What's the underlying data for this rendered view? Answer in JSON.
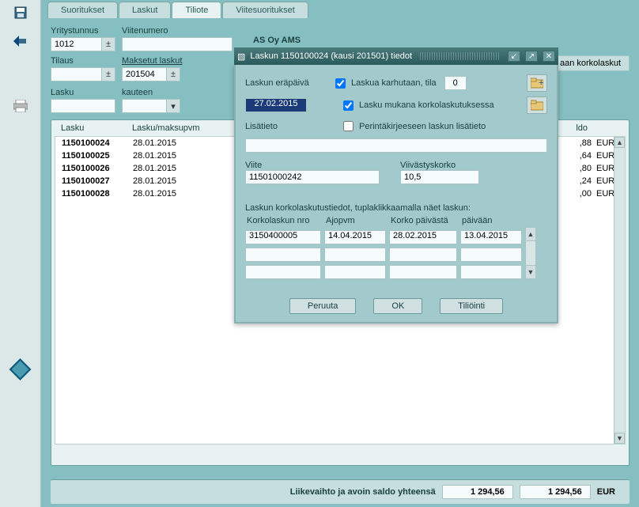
{
  "tabs": {
    "suoritukset": "Suoritukset",
    "laskut": "Laskut",
    "tiliote": "Tiliote",
    "viitesuoritukset": "Viitesuoritukset"
  },
  "filters": {
    "yritystunnus_label": "Yritystunnus",
    "yritystunnus_value": "1012",
    "tilaus_label": "Tilaus",
    "lasku_label": "Lasku",
    "viitenumero_label": "Viitenumero",
    "maksetut_label": "Maksetut laskut",
    "maksetut_value": "201504",
    "kauteen_label": "kauteen"
  },
  "company": "AS Oy AMS",
  "side_button": "aan korkolaskut",
  "list": {
    "head_lasku": "Lasku",
    "head_pvm": "Lasku/maksupvm",
    "head_saldo": "ldo",
    "rows": [
      {
        "lasku": "1150100024",
        "pvm": "28.01.2015",
        "saldo": ",88",
        "cur": "EUR"
      },
      {
        "lasku": "1150100025",
        "pvm": "28.01.2015",
        "saldo": ",64",
        "cur": "EUR"
      },
      {
        "lasku": "1150100026",
        "pvm": "28.01.2015",
        "saldo": ",80",
        "cur": "EUR"
      },
      {
        "lasku": "1150100027",
        "pvm": "28.01.2015",
        "saldo": ",24",
        "cur": "EUR"
      },
      {
        "lasku": "1150100028",
        "pvm": "28.01.2015",
        "saldo": ",00",
        "cur": "EUR"
      }
    ]
  },
  "footer": {
    "label": "Liikevaihto ja avoin saldo yhteensä",
    "total1": "1 294,56",
    "total2": "1 294,56",
    "cur": "EUR"
  },
  "dialog": {
    "title": "Laskun 1150100024 (kausi 201501) tiedot",
    "erapaiva_label": "Laskun eräpäivä",
    "erapaiva_value": "27.02.2015",
    "chk_karhutaan": "Laskua karhutaan, tila",
    "karhutaan_value": "0",
    "chk_korkolaskutus": "Lasku mukana korkolaskutuksessa",
    "chk_perinta": "Perintäkirjeeseen laskun lisätieto",
    "lisatieto_label": "Lisätieto",
    "lisatieto_value": "",
    "viite_label": "Viite",
    "viite_value": "11501000242",
    "viivastyskorko_label": "Viivästyskorko",
    "viivastyskorko_value": "10,5",
    "grid_title": "Laskun korkolaskutustiedot, tuplaklikkaamalla näet laskun:",
    "grid_headers": {
      "nro": "Korkolaskun nro",
      "ajopvm": "Ajopvm",
      "alku": "Korko päivästä",
      "loppu": "päivään"
    },
    "grid_rows": [
      {
        "nro": "3150400005",
        "ajopvm": "14.04.2015",
        "alku": "28.02.2015",
        "loppu": "13.04.2015"
      }
    ],
    "buttons": {
      "peruuta": "Peruuta",
      "ok": "OK",
      "tiliointi": "Tiliöinti"
    }
  }
}
